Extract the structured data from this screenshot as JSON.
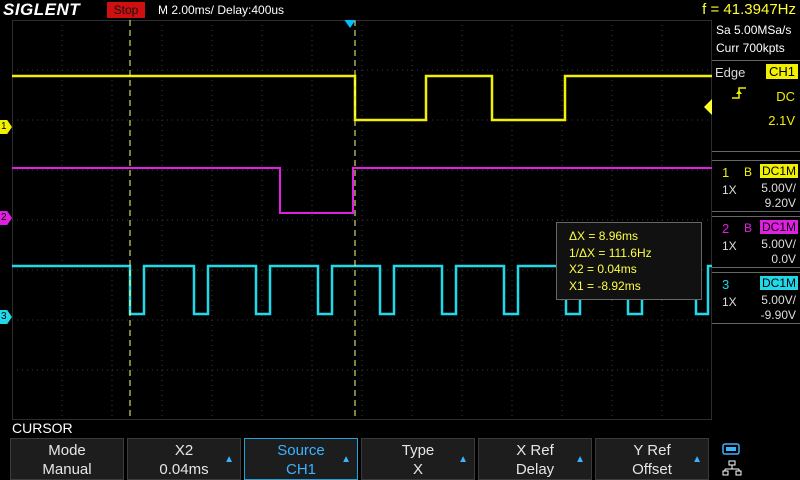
{
  "topbar": {
    "brand": "SIGLENT",
    "run_status": "Stop",
    "timebase": "M 2.00ms/ Delay:400us",
    "frequency": "f = 41.3947Hz"
  },
  "acquisition": {
    "sample_rate": "Sa 5.00MSa/s",
    "memory_depth": "Curr 700kpts"
  },
  "trigger": {
    "type": "Edge",
    "source": "CH1",
    "coupling": "DC",
    "level": "2.1V"
  },
  "channels": [
    {
      "number": "1",
      "bw": "B",
      "coupling": "DC1M",
      "probe": "1X",
      "scale": "5.00V/",
      "offset": "9.20V",
      "color": "#f0f000"
    },
    {
      "number": "2",
      "bw": "B",
      "coupling": "DC1M",
      "probe": "1X",
      "scale": "5.00V/",
      "offset": "0.0V",
      "color": "#e020e0"
    },
    {
      "number": "3",
      "bw": "",
      "coupling": "DC1M",
      "probe": "1X",
      "scale": "5.00V/",
      "offset": "-9.90V",
      "color": "#20d8e8"
    }
  ],
  "ground_markers": [
    "1",
    "2",
    "3"
  ],
  "cursor_readout": {
    "delta_x": "ΔX = 8.96ms",
    "inv_delta_x": "1/ΔX = 111.6Hz",
    "x2": "X2 = 0.04ms",
    "x1": "X1 = -8.92ms"
  },
  "menu": {
    "title": "CURSOR",
    "softkeys": [
      {
        "label": "Mode",
        "value": "Manual",
        "arrow": false,
        "active": false
      },
      {
        "label": "X2",
        "value": "0.04ms",
        "arrow": true,
        "active": false
      },
      {
        "label": "Source",
        "value": "CH1",
        "arrow": true,
        "active": true
      },
      {
        "label": "Type",
        "value": "X",
        "arrow": true,
        "active": false
      },
      {
        "label": "X Ref",
        "value": "Delay",
        "arrow": true,
        "active": false
      },
      {
        "label": "Y Ref",
        "value": "Offset",
        "arrow": true,
        "active": false
      }
    ]
  },
  "colors": {
    "ch1": "#f0f000",
    "ch2": "#e020e0",
    "ch3": "#20d8e8",
    "trigger_marker": "#00bfff",
    "cursor": "#ffff80",
    "stop_badge": "#d01010"
  },
  "icons": [
    "trigger-rising-edge-icon",
    "usb-icon",
    "network-icon",
    "trigger-position-icon"
  ]
}
